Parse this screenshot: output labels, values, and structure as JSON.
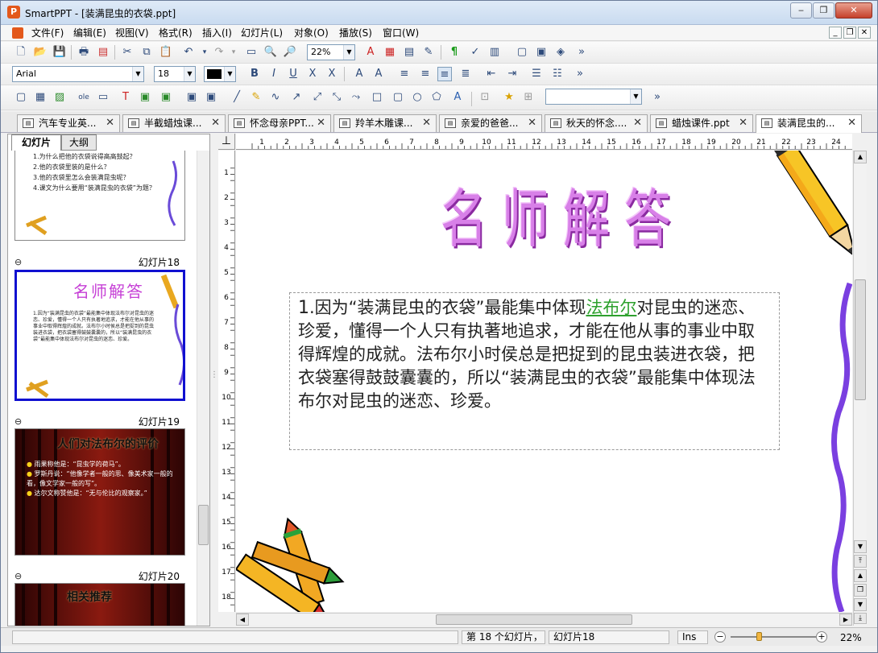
{
  "window": {
    "title": "SmartPPT - [装满昆虫的衣袋.ppt]",
    "min_label": "‒",
    "max_label": "❐",
    "close_label": "✕"
  },
  "menu": [
    "文件(F)",
    "编辑(E)",
    "视图(V)",
    "格式(R)",
    "插入(I)",
    "幻灯片(L)",
    "对象(O)",
    "播放(S)",
    "窗口(W)"
  ],
  "toolbar": {
    "zoom_value": "22%",
    "font_name": "Arial",
    "font_size": "18",
    "more": "»"
  },
  "tabs": [
    {
      "label": "汽车专业英...",
      "close": "✕"
    },
    {
      "label": "半截蜡烛课...",
      "close": "✕"
    },
    {
      "label": "怀念母亲PPT...",
      "close": "✕"
    },
    {
      "label": "羚羊木雕课...",
      "close": "✕"
    },
    {
      "label": "亲爱的爸爸...",
      "close": "✕"
    },
    {
      "label": "秋天的怀念....",
      "close": "✕"
    },
    {
      "label": "蜡烛课件.ppt",
      "close": "✕"
    },
    {
      "label": "装满昆虫的...",
      "close": "✕"
    }
  ],
  "left_panel": {
    "tab_slides": "幻灯片",
    "tab_outline": "大纲",
    "slide17_lines": [
      "1.为什么把他的衣袋说得高高鼓起？",
      "2.他的衣袋里装的是什么？",
      "3.他的衣袋里怎么会装满昆虫呢？",
      "4.课文为什么要用“装满昆虫的衣袋”为题？"
    ],
    "slide18": {
      "label": "幻灯片18",
      "title": "名师解答",
      "text": "1.因为“装满昆虫的衣袋”最能集中体现法布尔对昆虫的迷恋、珍爱，懂得一个人只有执著地追求，才能在他从事的事业中取得辉煌的成就。法布尔小时侯总是把捉到的昆虫装进衣袋，把衣袋塞得鼓鼓囊囊的，所以“装满昆虫的衣袋”最能集中体现法布尔对昆虫的迷恋、珍爱。"
    },
    "slide19": {
      "label": "幻灯片19",
      "title": "人们对法布尔的评价",
      "items": [
        "雨果称他是：“昆虫学的荷马”。",
        "罗斯丹说：“他像学者一般的思、像美术家一般的看，像文学家一般的写”。",
        "达尔文称赞他是：“无与伦比的观察家。”"
      ]
    },
    "slide20": {
      "label": "幻灯片20",
      "title": "相关推荐"
    }
  },
  "ruler": {
    "h": [
      "1",
      "2",
      "3",
      "4",
      "5",
      "6",
      "7",
      "8",
      "9",
      "10",
      "11",
      "12",
      "13",
      "14",
      "15",
      "16",
      "17",
      "18",
      "19",
      "20",
      "21",
      "22",
      "23",
      "24"
    ],
    "v": [
      "1",
      "2",
      "3",
      "4",
      "5",
      "6",
      "7",
      "8",
      "9",
      "10",
      "11",
      "12",
      "13",
      "14",
      "15",
      "16",
      "17",
      "18"
    ]
  },
  "slide": {
    "title": "名师解答",
    "num": "1",
    "text_before": ".因为“装满昆虫的衣袋”最能集中体现",
    "link": "法布尔",
    "text_after": "对昆虫的迷恋、珍爱，懂得一个人只有执著地追求，才能在他从事的事业中取得辉煌的成就。法布尔小时侯总是把捉到的昆虫装进衣袋，把衣袋塞得鼓鼓囊囊的，所以“装满昆虫的衣袋”最能集中体现法布尔对昆虫的迷恋、珍爱。"
  },
  "status": {
    "slide_pos": "第 18 个幻灯片，",
    "slide_name": "幻灯片18",
    "ins": "Ins",
    "zoom": "22%",
    "zoom_fraction": 0.33
  },
  "colors": {
    "title_purple": "#c640d6",
    "link_green": "#2ea12e",
    "selection": "#1010d0",
    "curtain": "#5a0a0a"
  }
}
